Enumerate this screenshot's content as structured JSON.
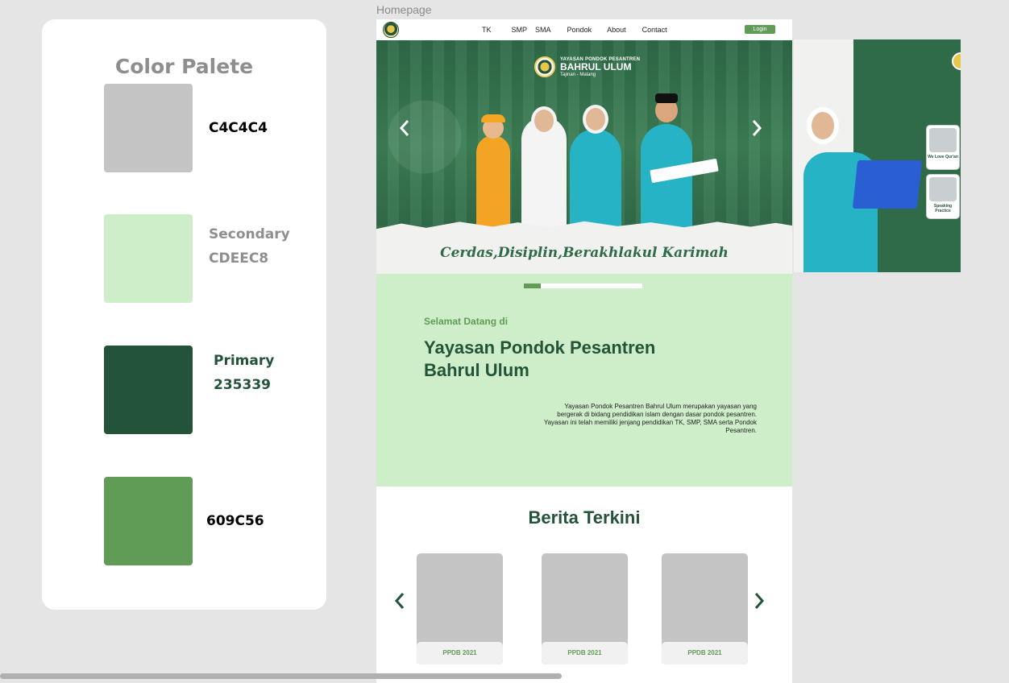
{
  "palette": {
    "title": "Color Palete",
    "swatches": [
      {
        "label": "C4C4C4",
        "role": "",
        "hex": "#C4C4C4"
      },
      {
        "label": "CDEEC8",
        "role": "Secondary",
        "hex": "#CDEEC8"
      },
      {
        "label": "235339",
        "role": "Primary",
        "hex": "#235339"
      },
      {
        "label": "609C56",
        "role": "",
        "hex": "#609C56"
      }
    ]
  },
  "frame": {
    "label": "Homepage"
  },
  "nav": {
    "links": [
      "TK",
      "SMP",
      "SMA",
      "Pondok",
      "About",
      "Contact"
    ],
    "login": "Login"
  },
  "hero": {
    "brand_small": "YAYASAN PONDOK PESANTREN",
    "brand_big": "BAHRUL ULUM",
    "brand_sub": "Tajinan - Malang",
    "tagline": "Cerdas,Disiplin,Berakhlakul Karimah",
    "prev_icon": "chevron-left-icon",
    "next_icon": "chevron-right-icon"
  },
  "side_slide": {
    "cards": [
      {
        "caption": "We Love Qur'an"
      },
      {
        "caption": "Speaking Practice"
      }
    ]
  },
  "welcome": {
    "slider_progress": 0.14,
    "subtitle": "Selamat Datang di",
    "title": "Yayasan Pondok Pesantren Bahrul Ulum",
    "description": "Yayasan Pondok Pesantren Bahrul Ulum merupakan yayasan yang bergerak di bidang pendidikan islam dengan dasar pondok pesantren. Yayasan ini telah memiliki jenjang pendidikan TK, SMP, SMA serta Pondok Pesantren."
  },
  "news": {
    "title": "Berita Terkini",
    "cards": [
      {
        "tag": "PPDB 2021"
      },
      {
        "tag": "PPDB 2021"
      },
      {
        "tag": "PPDB 2021"
      }
    ]
  },
  "colors": {
    "primary": "#235339",
    "secondary": "#CDEEC8",
    "accent": "#609C56",
    "neutral": "#C4C4C4"
  }
}
